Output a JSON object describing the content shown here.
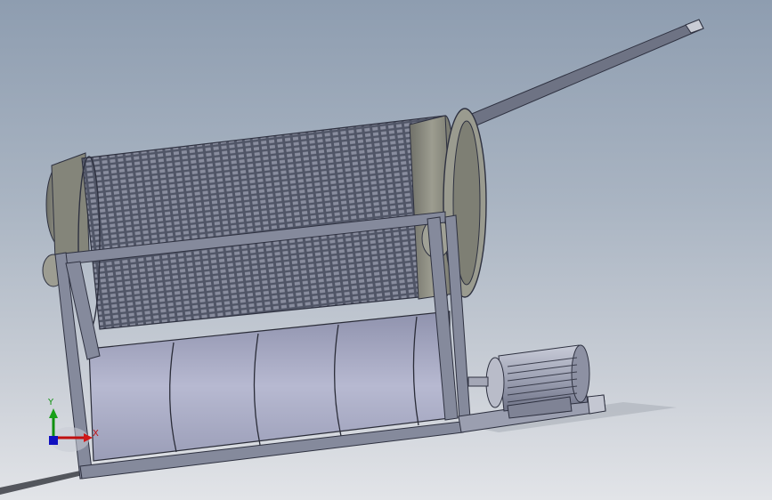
{
  "viewport": {
    "background_top": "#8e9db0",
    "background_bottom": "#e2e4e8"
  },
  "model": {
    "body_color": "#8d93a6",
    "frame_color": "#7d8396",
    "mesh_color": "#2e3140",
    "flange_color": "#85857a",
    "drum_color": "#a9acc4"
  },
  "triad": {
    "x_label": "X",
    "y_label": "Y",
    "x_color": "#c01010",
    "y_color": "#109010",
    "z_color": "#1010c0"
  }
}
